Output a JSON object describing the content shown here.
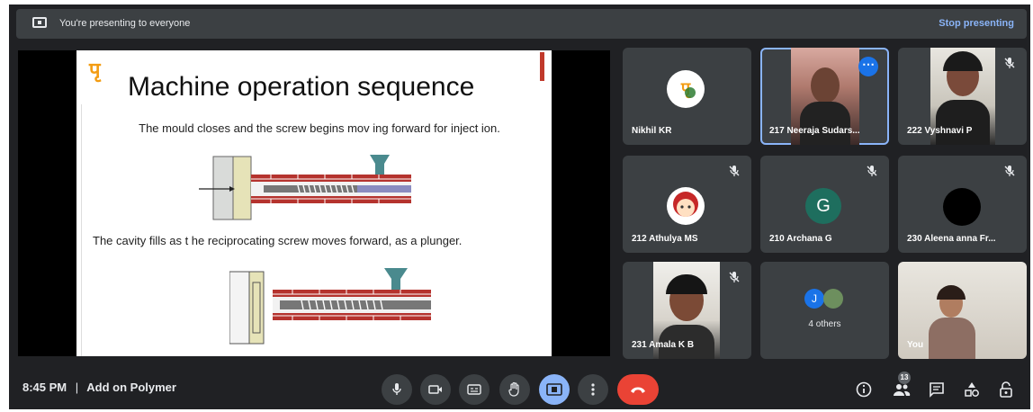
{
  "top_bar": {
    "presenting_text": "You're presenting to everyone",
    "stop_label": "Stop presenting"
  },
  "slide": {
    "logo_text": "पृ",
    "title": "Machine operation sequence",
    "text1": "The mould closes and the screw begins mov ing forward for inject ion.",
    "text2": "The cavity fills as t he reciprocating screw moves forward, as a  plunger."
  },
  "participants": [
    {
      "name": "Nikhil KR",
      "muted": false,
      "kind": "logo"
    },
    {
      "name": "217 Neeraja Sudars...",
      "muted": false,
      "kind": "video",
      "active": true
    },
    {
      "name": "222 Vyshnavi P",
      "muted": true,
      "kind": "video"
    },
    {
      "name": "212 Athulya MS",
      "muted": true,
      "kind": "avatar"
    },
    {
      "name": "210 Archana G",
      "muted": true,
      "kind": "letter",
      "letter": "G"
    },
    {
      "name": "230 Aleena anna Fr...",
      "muted": true,
      "kind": "black"
    },
    {
      "name": "231 Amala K B",
      "muted": true,
      "kind": "video"
    },
    {
      "name": "4 others",
      "muted": false,
      "kind": "others",
      "letter": "J"
    },
    {
      "name": "You",
      "muted": false,
      "kind": "video"
    }
  ],
  "bottom_bar": {
    "time": "8:45 PM",
    "separator": "|",
    "meeting_title": "Add on Polymer",
    "participant_count": "13"
  },
  "colors": {
    "background": "#202124",
    "tile": "#3c4043",
    "accent": "#8ab4f8",
    "end_call": "#ea4335",
    "more_button": "#1a73e8"
  },
  "icons": [
    "present-screen-icon",
    "mic-icon",
    "camera-icon",
    "captions-icon",
    "raise-hand-icon",
    "present-now-icon",
    "more-options-icon",
    "end-call-icon",
    "info-icon",
    "people-icon",
    "chat-icon",
    "activities-icon",
    "host-controls-icon",
    "mic-off-icon"
  ]
}
